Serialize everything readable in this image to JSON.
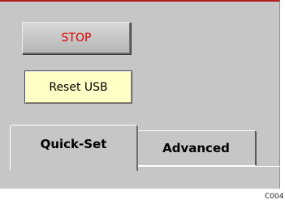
{
  "controls": {
    "stop_label": "STOP",
    "reset_usb_label": "Reset USB"
  },
  "tabs": [
    {
      "label": "Quick-Set",
      "active": true
    },
    {
      "label": "Advanced",
      "active": false
    }
  ],
  "figure_code": "C004",
  "colors": {
    "stop_text": "#e00000",
    "reset_bg": "#ffffc6",
    "panel_bg": "#c6c6c6",
    "panel_top_border": "#b21f1f"
  }
}
